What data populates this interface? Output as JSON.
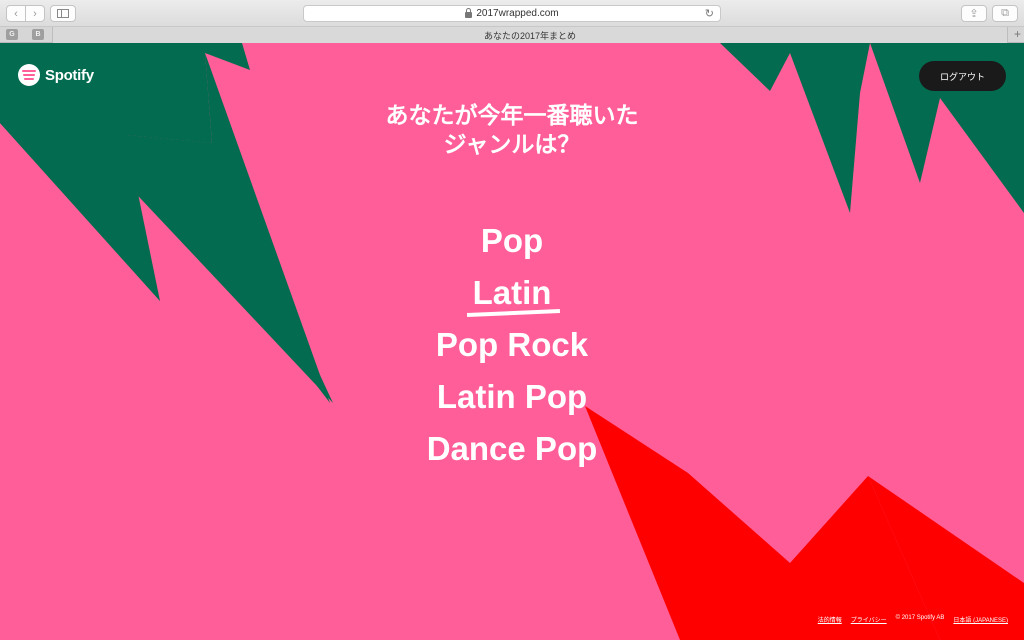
{
  "browser": {
    "url": "2017wrapped.com",
    "tab_title": "あなたの2017年まとめ",
    "back_icon": "‹",
    "forward_icon": "›",
    "reload_icon": "↻",
    "share_icon": "⇪",
    "tabs_icon": "⧉",
    "new_tab_icon": "+",
    "bookmarks": [
      {
        "label": "G"
      },
      {
        "label": "B"
      }
    ]
  },
  "header": {
    "logo_text": "Spotify",
    "logout_label": "ログアウト"
  },
  "main": {
    "question_line1": "あなたが今年一番聴いた",
    "question_line2": "ジャンルは？",
    "genres": [
      "Pop",
      "Latin",
      "Pop Rock",
      "Latin Pop",
      "Dance Pop"
    ],
    "highlighted_genre_index": 1
  },
  "footer": {
    "legal": "法的情報",
    "privacy": "プライバシー",
    "copyright": "© 2017 Spotify AB",
    "language": "日本語 (JAPANESE)"
  },
  "colors": {
    "background": "#ff5e98",
    "green_shape": "#036b4f",
    "red_shape": "#ff0000",
    "button_dark": "#1a1a1a"
  }
}
